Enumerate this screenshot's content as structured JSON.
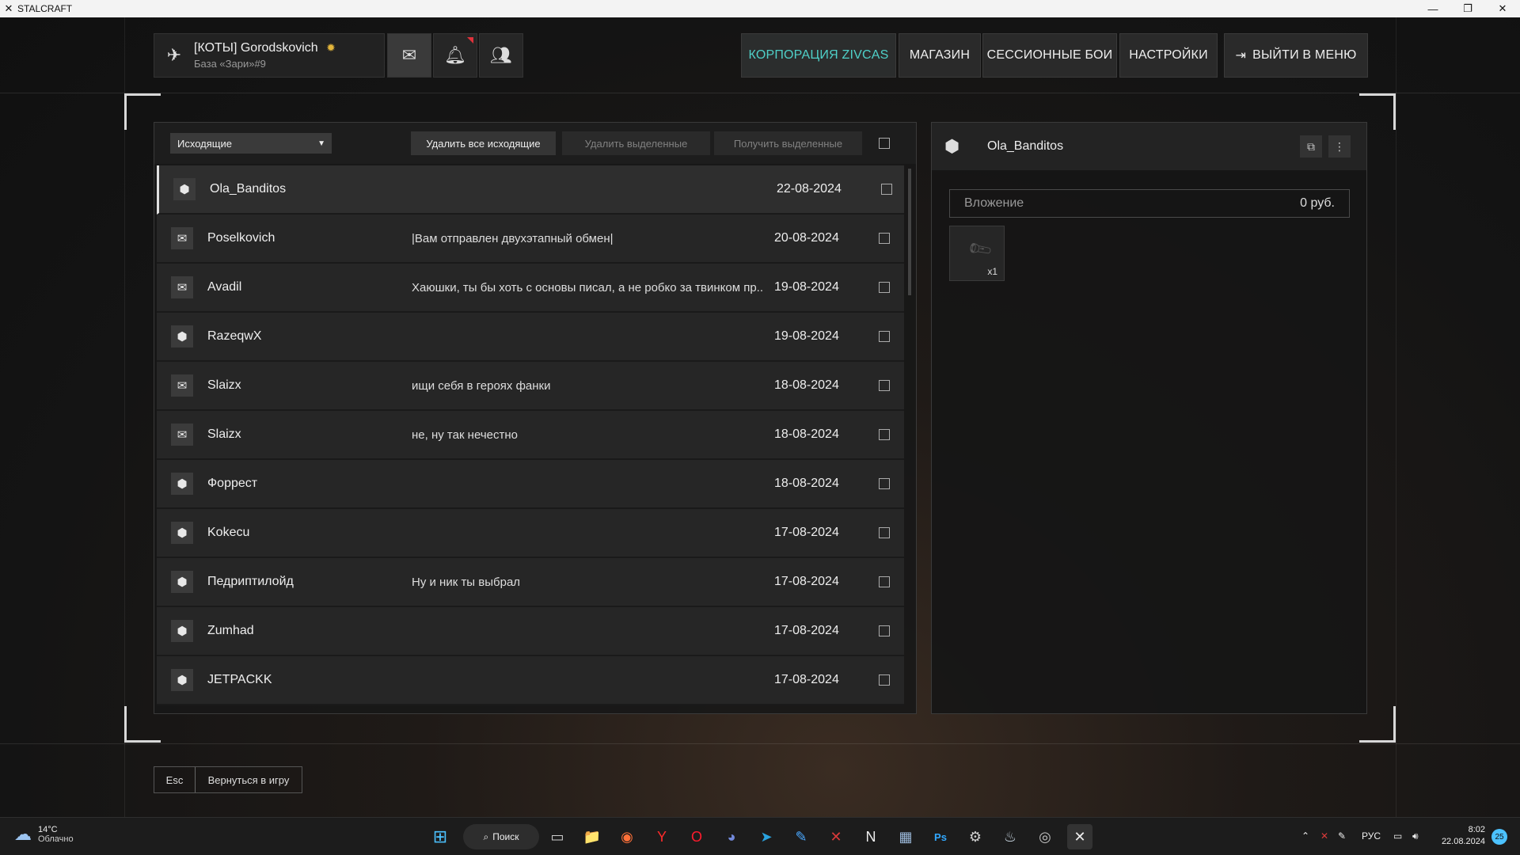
{
  "window": {
    "title": "STALCRAFT",
    "app_icon": "stalcraft-logo-icon",
    "controls": {
      "minimize": "—",
      "maximize": "❐",
      "close": "✕"
    }
  },
  "header": {
    "profile": {
      "name": "[КОТЫ] Gorodskovich",
      "base": "База «Зари»#9",
      "badge_icon": "rank-badge-icon"
    },
    "icon_buttons": [
      {
        "name": "mail-icon",
        "glyph": "✉"
      },
      {
        "name": "bell-icon",
        "glyph": "🔔"
      },
      {
        "name": "friends-icon",
        "glyph": "👥"
      }
    ],
    "nav": {
      "corporation": "КОРПОРАЦИЯ ZIVCAS",
      "shop": "МАГАЗИН",
      "session_battles": "СЕССИОННЫЕ БОИ",
      "settings": "НАСТРОЙКИ",
      "exit_menu": "ВЫЙТИ В МЕНЮ"
    },
    "accent_color": "#4fd0c8"
  },
  "mail": {
    "folder": "Исходящие",
    "buttons": {
      "delete_all": "Удалить все исходящие",
      "delete_selected": "Удалить выделенные",
      "receive_selected": "Получить выделенные"
    },
    "rows": [
      {
        "type": "package",
        "sender": "Ola_Banditos",
        "subject": "",
        "date": "22-08-2024"
      },
      {
        "type": "letter",
        "sender": "Poselkovich",
        "subject": "|Вам отправлен двухэтапный обмен|",
        "date": "20-08-2024"
      },
      {
        "type": "letter",
        "sender": "Avadil",
        "subject": "Хаюшки, ты бы хоть с основы писал, а не робко за твинком пр..",
        "date": "19-08-2024"
      },
      {
        "type": "package",
        "sender": "RazeqwX",
        "subject": "",
        "date": "19-08-2024"
      },
      {
        "type": "letter",
        "sender": "Slaizx",
        "subject": "ищи себя в героях фанки",
        "date": "18-08-2024"
      },
      {
        "type": "letter",
        "sender": "Slaizx",
        "subject": "не, ну так нечестно",
        "date": "18-08-2024"
      },
      {
        "type": "package",
        "sender": "Форрест",
        "subject": "",
        "date": "18-08-2024"
      },
      {
        "type": "package",
        "sender": "Kokecu",
        "subject": "",
        "date": "17-08-2024"
      },
      {
        "type": "package",
        "sender": "Педриптилойд",
        "subject": "Ну и ник ты выбрал",
        "date": "17-08-2024"
      },
      {
        "type": "package",
        "sender": "Zumhad",
        "subject": "",
        "date": "17-08-2024"
      },
      {
        "type": "package",
        "sender": "JETPACKK",
        "subject": "",
        "date": "17-08-2024"
      }
    ]
  },
  "detail": {
    "recipient": "Ola_Banditos",
    "attachment_label": "Вложение",
    "attachment_amount": "0 руб.",
    "item": {
      "icon": "item-icon",
      "quantity": "x1"
    }
  },
  "footer": {
    "esc_key": "Esc",
    "return_label": "Вернуться в игру"
  },
  "taskbar": {
    "weather_temp": "14°C",
    "weather_cond": "Облачно",
    "search": "Поиск",
    "apps": [
      {
        "name": "task-view-icon",
        "glyph": "▭",
        "color": "#cfcfcf"
      },
      {
        "name": "file-explorer-icon",
        "glyph": "📁",
        "color": "#f2c14e"
      },
      {
        "name": "firefox-icon",
        "glyph": "◉",
        "color": "#ff7139"
      },
      {
        "name": "yandex-browser-icon",
        "glyph": "Y",
        "color": "#ff2b2b"
      },
      {
        "name": "opera-icon",
        "glyph": "O",
        "color": "#ff1b2d"
      },
      {
        "name": "discord-icon",
        "glyph": "◕",
        "color": "#7289da"
      },
      {
        "name": "telegram-icon",
        "glyph": "➤",
        "color": "#2aa3df"
      },
      {
        "name": "feather-app-icon",
        "glyph": "✎",
        "color": "#4aa8ff"
      },
      {
        "name": "stalcraft-launcher-icon",
        "glyph": "✕",
        "color": "#d93a3a"
      },
      {
        "name": "notion-icon",
        "glyph": "N",
        "color": "#eeeeee"
      },
      {
        "name": "image-viewer-icon",
        "glyph": "▦",
        "color": "#9ab7d8"
      },
      {
        "name": "photoshop-icon",
        "glyph": "Ps",
        "color": "#31a8ff"
      },
      {
        "name": "settings-icon",
        "glyph": "⚙",
        "color": "#cfcfcf"
      },
      {
        "name": "steam-icon",
        "glyph": "♨",
        "color": "#c7d5e0"
      },
      {
        "name": "obs-icon",
        "glyph": "◎",
        "color": "#c0c0c0"
      },
      {
        "name": "stalcraft-game-icon",
        "glyph": "✕",
        "color": "#eeeeee"
      }
    ],
    "language": "РУС",
    "time": "8:02",
    "date": "22.08.2024",
    "notifications": "25"
  }
}
